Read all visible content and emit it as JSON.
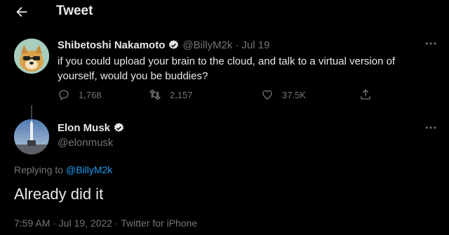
{
  "header": {
    "title": "Tweet"
  },
  "original_tweet": {
    "name": "Shibetoshi Nakamoto",
    "handle": "@BillyM2k",
    "separator": "·",
    "date": "Jul 19",
    "text": "if you could upload your brain to the cloud, and talk to a virtual version of yourself, would you be buddies?",
    "replies": "1,768",
    "retweets": "2,157",
    "likes": "37.5K"
  },
  "reply_tweet": {
    "name": "Elon Musk",
    "handle": "@elonmusk",
    "replying_prefix": "Replying to",
    "replying_to": "@BillyM2k",
    "text": "Already did it",
    "meta": "7:59 AM · Jul 19, 2022 · Twitter for iPhone"
  },
  "colors": {
    "accent": "#1d9bf0",
    "muted": "#71767b",
    "background": "#000000"
  }
}
